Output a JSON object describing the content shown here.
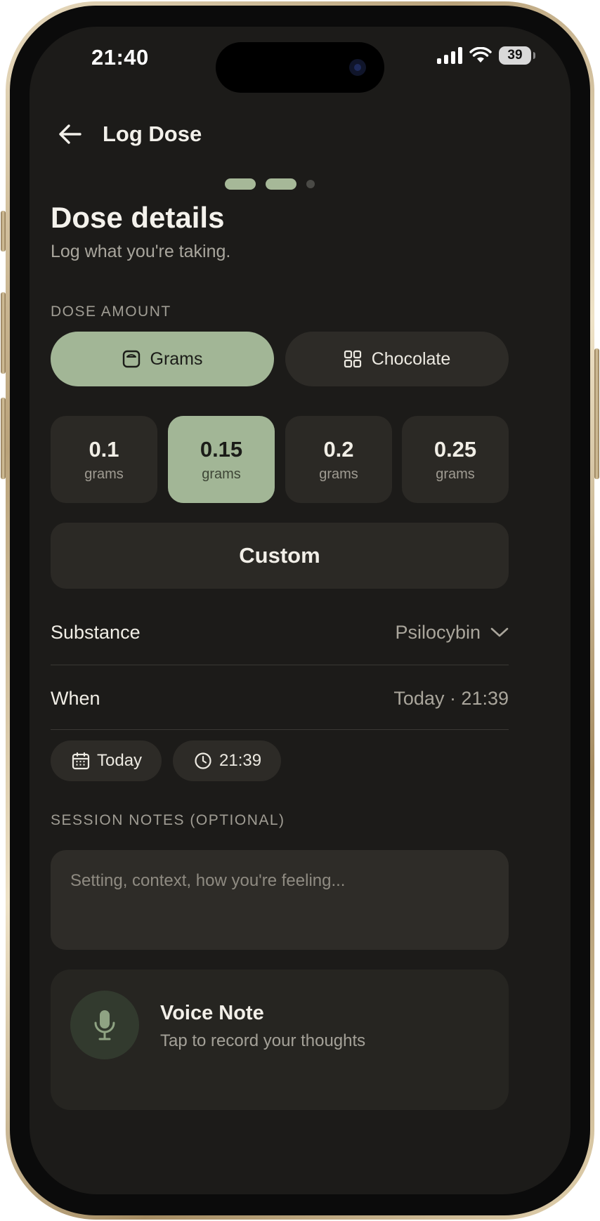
{
  "status_bar": {
    "time": "21:40",
    "battery": "39"
  },
  "header": {
    "title": "Log Dose"
  },
  "page": {
    "title": "Dose details",
    "subtitle": "Log what you're taking."
  },
  "dose_amount": {
    "label": "DOSE AMOUNT",
    "modes": [
      {
        "label": "Grams",
        "icon": "scale-icon",
        "selected": true
      },
      {
        "label": "Chocolate",
        "icon": "grid-icon",
        "selected": false
      }
    ],
    "presets": [
      {
        "value": "0.1",
        "unit": "grams",
        "selected": false
      },
      {
        "value": "0.15",
        "unit": "grams",
        "selected": true
      },
      {
        "value": "0.2",
        "unit": "grams",
        "selected": false
      },
      {
        "value": "0.25",
        "unit": "grams",
        "selected": false
      }
    ],
    "custom_label": "Custom"
  },
  "substance": {
    "label": "Substance",
    "value": "Psilocybin"
  },
  "when": {
    "label": "When",
    "value": "Today · 21:39",
    "date_chip": "Today",
    "time_chip": "21:39"
  },
  "notes": {
    "label": "SESSION NOTES (OPTIONAL)",
    "placeholder": "Setting, context, how you're feeling..."
  },
  "voice_note": {
    "title": "Voice Note",
    "subtitle": "Tap to record your thoughts"
  },
  "colors": {
    "accent": "#a2b696",
    "background": "#1c1b19",
    "card": "#2b2925"
  }
}
